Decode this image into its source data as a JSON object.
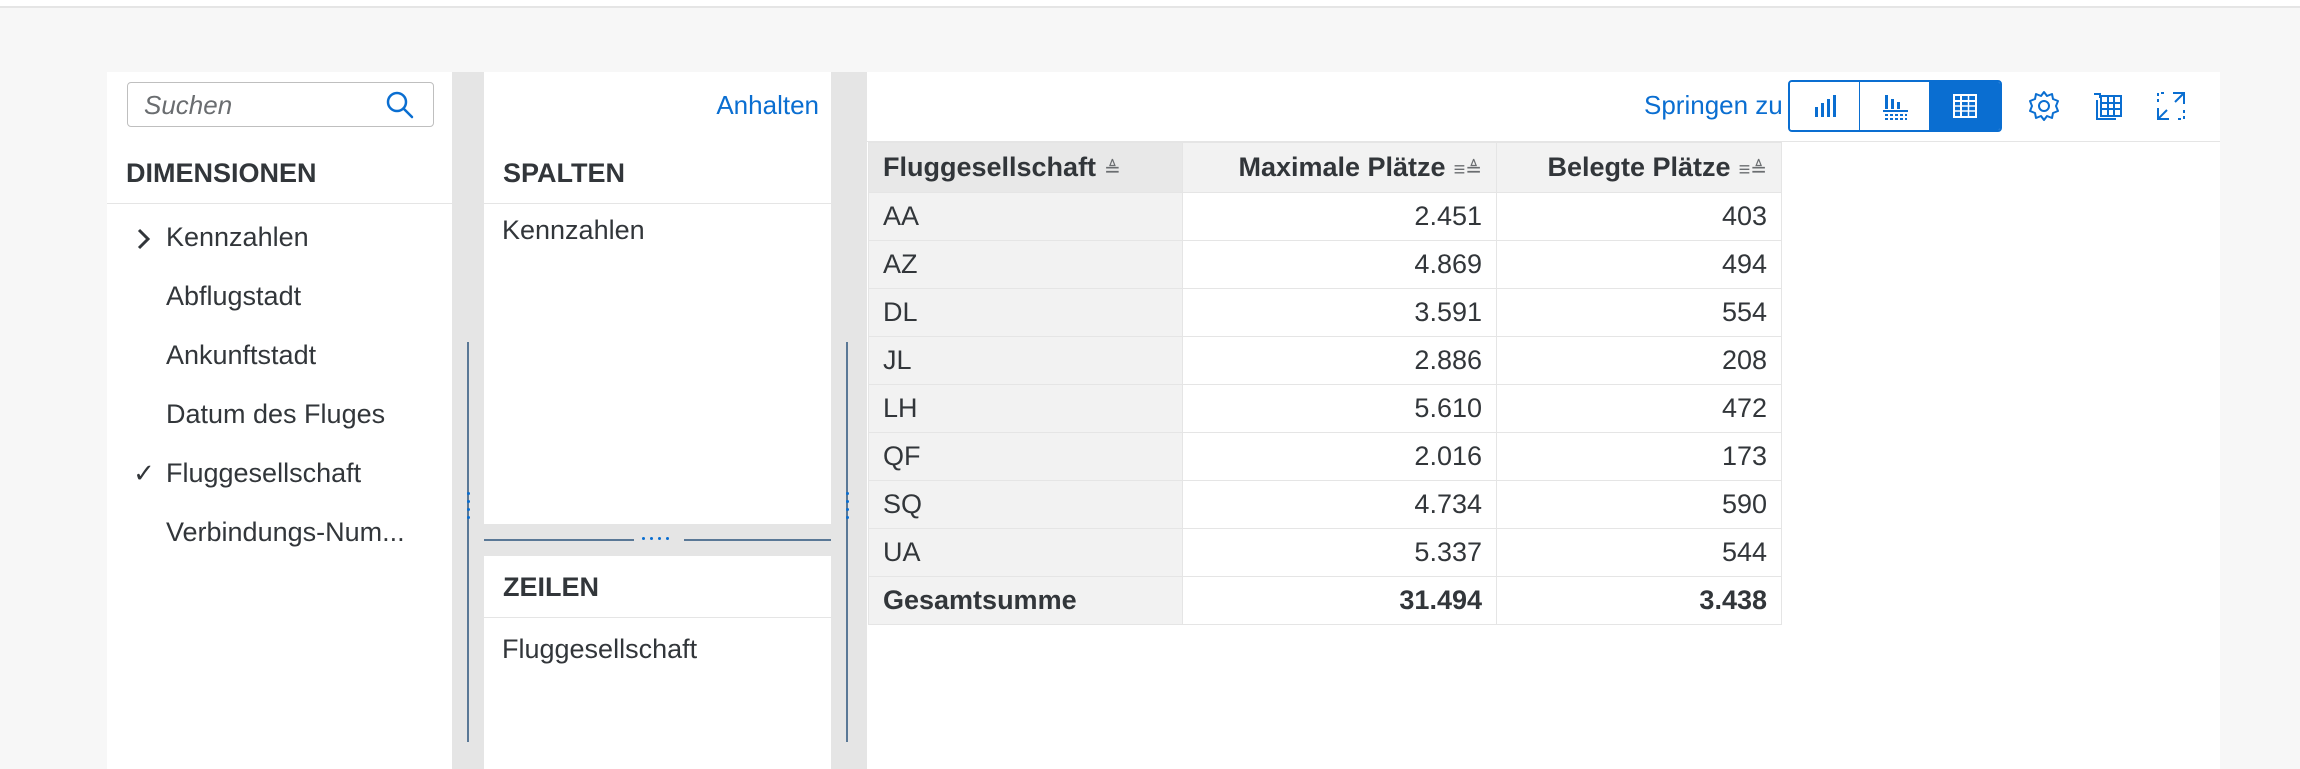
{
  "dimensions_panel": {
    "search_placeholder": "Suchen",
    "header": "DIMENSIONEN",
    "items": [
      {
        "label": "Kennzahlen",
        "mark": "›"
      },
      {
        "label": "Abflugstadt",
        "mark": ""
      },
      {
        "label": "Ankunftstadt",
        "mark": ""
      },
      {
        "label": "Datum des Fluges",
        "mark": ""
      },
      {
        "label": "Fluggesellschaft",
        "mark": "✓"
      },
      {
        "label": "Verbindungs-Num...",
        "mark": ""
      }
    ]
  },
  "columns_panel": {
    "pause_link": "Anhalten",
    "header": "SPALTEN",
    "item": "Kennzahlen"
  },
  "rows_panel": {
    "header": "ZEILEN",
    "item": "Fluggesellschaft"
  },
  "toolbar": {
    "jump_to": "Springen zu",
    "view_buttons": [
      "chart-view-icon",
      "chart-table-view-icon",
      "table-view-icon"
    ],
    "active_view": "table-view-icon",
    "icons": [
      "settings-icon",
      "export-icon",
      "fullscreen-icon"
    ]
  },
  "table": {
    "headers": [
      "Fluggesellschaft",
      "Maximale Plätze",
      "Belegte Plätze"
    ],
    "rows": [
      {
        "label": "AA",
        "max": "2.451",
        "occ": "403"
      },
      {
        "label": "AZ",
        "max": "4.869",
        "occ": "494"
      },
      {
        "label": "DL",
        "max": "3.591",
        "occ": "554"
      },
      {
        "label": "JL",
        "max": "2.886",
        "occ": "208"
      },
      {
        "label": "LH",
        "max": "5.610",
        "occ": "472"
      },
      {
        "label": "QF",
        "max": "2.016",
        "occ": "173"
      },
      {
        "label": "SQ",
        "max": "4.734",
        "occ": "590"
      },
      {
        "label": "UA",
        "max": "5.337",
        "occ": "544"
      }
    ],
    "total": {
      "label": "Gesamtsumme",
      "max": "31.494",
      "occ": "3.438"
    }
  },
  "colors": {
    "accent": "#0a6ed1",
    "header_bg": "#f2f2f2",
    "text": "#32363a"
  }
}
